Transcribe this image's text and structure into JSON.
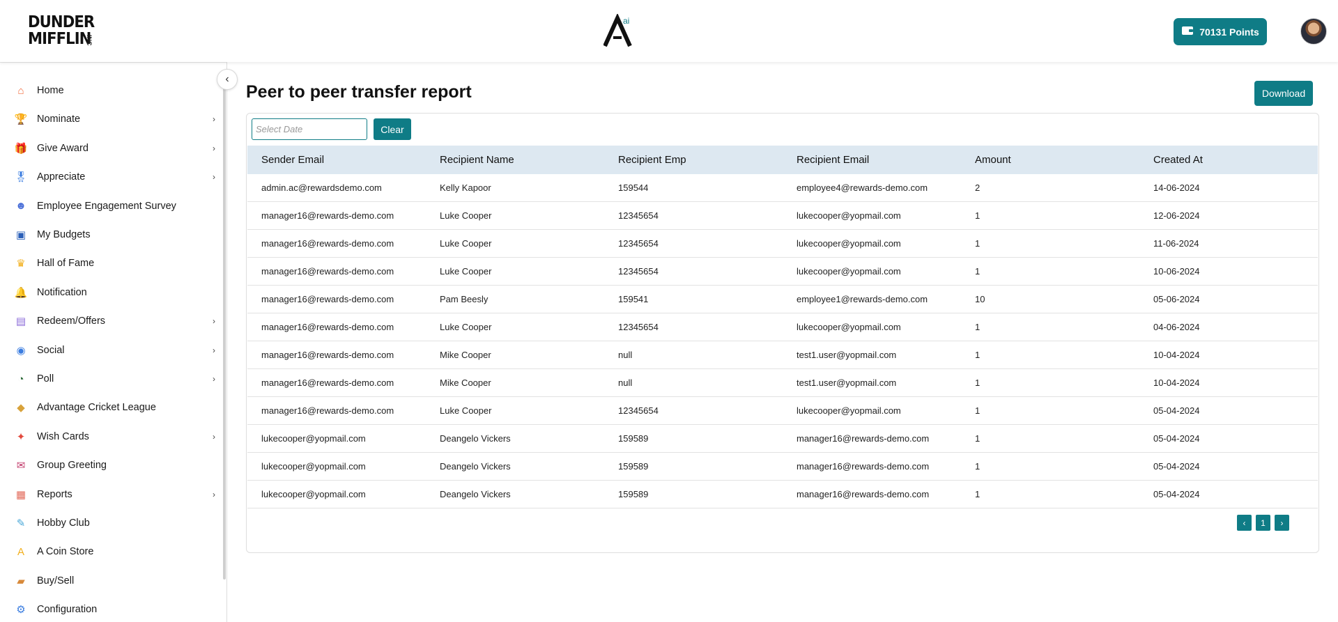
{
  "header": {
    "brand_line1": "DUNDER",
    "brand_line2": "MIFFLIN",
    "brand_suffix": "INC",
    "center_logo_sup": "ai",
    "points_label": "70131  Points"
  },
  "sidebar": {
    "items": [
      {
        "label": "Home",
        "icon": "home-icon",
        "chevron": false
      },
      {
        "label": "Nominate",
        "icon": "trophy-icon",
        "chevron": true
      },
      {
        "label": "Give Award",
        "icon": "gift-icon",
        "chevron": true
      },
      {
        "label": "Appreciate",
        "icon": "medal-icon",
        "chevron": true
      },
      {
        "label": "Employee Engagement Survey",
        "icon": "survey-icon",
        "chevron": false
      },
      {
        "label": "My Budgets",
        "icon": "wallet-icon",
        "chevron": false
      },
      {
        "label": "Hall of Fame",
        "icon": "crown-icon",
        "chevron": false
      },
      {
        "label": "Notification",
        "icon": "bell-icon",
        "chevron": false
      },
      {
        "label": "Redeem/Offers",
        "icon": "redeem-icon",
        "chevron": true
      },
      {
        "label": "Social",
        "icon": "social-icon",
        "chevron": true
      },
      {
        "label": "Poll",
        "icon": "poll-icon",
        "chevron": true
      },
      {
        "label": "Advantage Cricket League",
        "icon": "cricket-icon",
        "chevron": false
      },
      {
        "label": "Wish Cards",
        "icon": "party-popper-icon",
        "chevron": true
      },
      {
        "label": "Group Greeting",
        "icon": "envelope-icon",
        "chevron": false
      },
      {
        "label": "Reports",
        "icon": "clipboard-icon",
        "chevron": true
      },
      {
        "label": "Hobby Club",
        "icon": "hobby-icon",
        "chevron": false
      },
      {
        "label": "A Coin Store",
        "icon": "coin-icon",
        "chevron": false
      },
      {
        "label": "Buy/Sell",
        "icon": "shopping-icon",
        "chevron": false
      },
      {
        "label": "Configuration",
        "icon": "config-icon",
        "chevron": false
      }
    ]
  },
  "main": {
    "title": "Peer to peer transfer report",
    "download_label": "Download",
    "date_placeholder": "Select Date",
    "clear_label": "Clear",
    "columns": [
      "Sender Email",
      "Recipient Name",
      "Recipient Emp",
      "Recipient Email",
      "Amount",
      "Created At"
    ],
    "rows": [
      [
        "admin.ac@rewardsdemo.com",
        "Kelly Kapoor",
        "159544",
        "employee4@rewards-demo.com",
        "2",
        "14-06-2024"
      ],
      [
        "manager16@rewards-demo.com",
        "Luke Cooper",
        "12345654",
        "lukecooper@yopmail.com",
        "1",
        "12-06-2024"
      ],
      [
        "manager16@rewards-demo.com",
        "Luke Cooper",
        "12345654",
        "lukecooper@yopmail.com",
        "1",
        "11-06-2024"
      ],
      [
        "manager16@rewards-demo.com",
        "Luke Cooper",
        "12345654",
        "lukecooper@yopmail.com",
        "1",
        "10-06-2024"
      ],
      [
        "manager16@rewards-demo.com",
        "Pam Beesly",
        "159541",
        "employee1@rewards-demo.com",
        "10",
        "05-06-2024"
      ],
      [
        "manager16@rewards-demo.com",
        "Luke Cooper",
        "12345654",
        "lukecooper@yopmail.com",
        "1",
        "04-06-2024"
      ],
      [
        "manager16@rewards-demo.com",
        "Mike Cooper",
        "null",
        "test1.user@yopmail.com",
        "1",
        "10-04-2024"
      ],
      [
        "manager16@rewards-demo.com",
        "Mike Cooper",
        "null",
        "test1.user@yopmail.com",
        "1",
        "10-04-2024"
      ],
      [
        "manager16@rewards-demo.com",
        "Luke Cooper",
        "12345654",
        "lukecooper@yopmail.com",
        "1",
        "05-04-2024"
      ],
      [
        "lukecooper@yopmail.com",
        "Deangelo Vickers",
        "159589",
        "manager16@rewards-demo.com",
        "1",
        "05-04-2024"
      ],
      [
        "lukecooper@yopmail.com",
        "Deangelo Vickers",
        "159589",
        "manager16@rewards-demo.com",
        "1",
        "05-04-2024"
      ],
      [
        "lukecooper@yopmail.com",
        "Deangelo Vickers",
        "159589",
        "manager16@rewards-demo.com",
        "1",
        "05-04-2024"
      ]
    ],
    "pagination": {
      "prev": "‹",
      "current": "1",
      "next": "›"
    }
  },
  "colors": {
    "accent": "#0f7c86",
    "table_header_bg": "#dde8f1"
  }
}
